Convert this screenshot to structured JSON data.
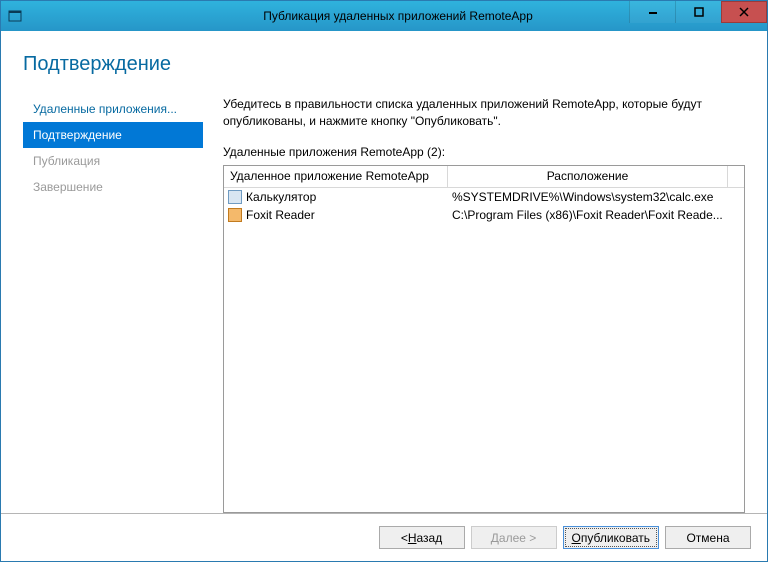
{
  "titlebar": {
    "title": "Публикация удаленных приложений RemoteApp"
  },
  "heading": "Подтверждение",
  "sidebar": {
    "steps": [
      {
        "label": "Удаленные приложения...",
        "state": "link"
      },
      {
        "label": "Подтверждение",
        "state": "active"
      },
      {
        "label": "Публикация",
        "state": "disabled"
      },
      {
        "label": "Завершение",
        "state": "disabled"
      }
    ]
  },
  "main": {
    "instruction": "Убедитесь в правильности списка удаленных приложений RemoteApp, которые будут опубликованы, и нажмите кнопку \"Опубликовать\".",
    "listLabel": "Удаленные приложения RemoteApp (2):",
    "columns": {
      "app": "Удаленное приложение RemoteApp",
      "location": "Расположение"
    },
    "rows": [
      {
        "icon": "calc",
        "name": "Калькулятор",
        "path": "%SYSTEMDRIVE%\\Windows\\system32\\calc.exe"
      },
      {
        "icon": "foxit",
        "name": "Foxit Reader",
        "path": "C:\\Program Files (x86)\\Foxit Reader\\Foxit Reade..."
      }
    ]
  },
  "buttons": {
    "backPrefix": "< ",
    "backU": "Н",
    "backRest": "азад",
    "nextLabel": "Далее >",
    "publishU": "О",
    "publishRest": "публиковать",
    "cancel": "Отмена"
  }
}
